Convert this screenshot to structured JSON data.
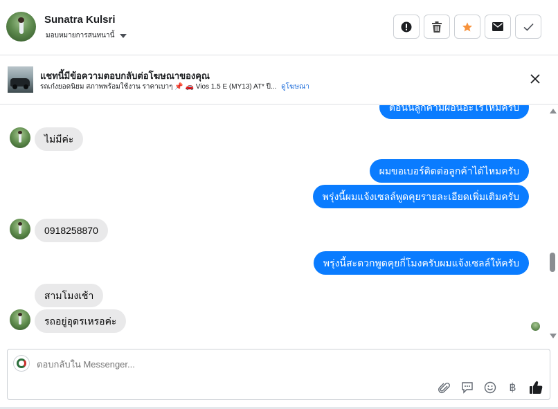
{
  "header": {
    "contact_name": "Sunatra Kulsri",
    "assign_label": "มอบหมายการสนทนานี้",
    "actions": [
      {
        "name": "report-button",
        "icon": "alert-circle-icon"
      },
      {
        "name": "delete-button",
        "icon": "trash-icon"
      },
      {
        "name": "star-button",
        "icon": "star-icon"
      },
      {
        "name": "mark-unread-button",
        "icon": "envelope-icon"
      },
      {
        "name": "mark-done-button",
        "icon": "check-icon"
      }
    ]
  },
  "ad": {
    "title": "แชทนี้มีข้อความตอบกลับต่อโฆษณาของคุณ",
    "subtitle": "รถเก๋งยอดนิยม สภาพพร้อมใช้งาน ราคาเบาๆ",
    "pin_emoji": "📌",
    "car_emoji": "🚗",
    "model_text": "Vios 1.5 E (MY13) AT* ปี...",
    "view_ad_link": "ดูโฆษณา"
  },
  "messages": [
    {
      "dir": "out",
      "text": "ต่อนี้นลูกค้ามีผ่อนอะไรไหมครับ"
    },
    {
      "dir": "in",
      "text": "ไม่มีค่ะ"
    },
    {
      "dir": "out",
      "text": "ผมขอเบอร์ติดต่อลูกค้าได้ไหมครับ"
    },
    {
      "dir": "out",
      "text": "พรุ่งนี้ผมแจ้งเซลล์พูดคุยรายละเอียดเพิ่มเติมครับ"
    },
    {
      "dir": "in",
      "text": "0918258870"
    },
    {
      "dir": "out",
      "text": "พรุ่งนี้สะดวกพูดคุยกี่โมงครับผมแจ้งเซลล์ให้ครับ"
    },
    {
      "dir": "in",
      "text": "สามโมงเช้า"
    },
    {
      "dir": "in",
      "text": "รถอยู่อุดรเหรอค่ะ"
    }
  ],
  "composer": {
    "placeholder": "ตอบกลับใน Messenger...",
    "icons": [
      "attachment-icon",
      "saved-reply-icon",
      "emoji-icon",
      "baht-icon",
      "like-icon"
    ],
    "baht_symbol": "฿"
  },
  "colors": {
    "outgoing_bubble": "#0a7cff",
    "incoming_bubble": "#e9e9ea",
    "link": "#216fdb",
    "star": "#f7923b"
  }
}
